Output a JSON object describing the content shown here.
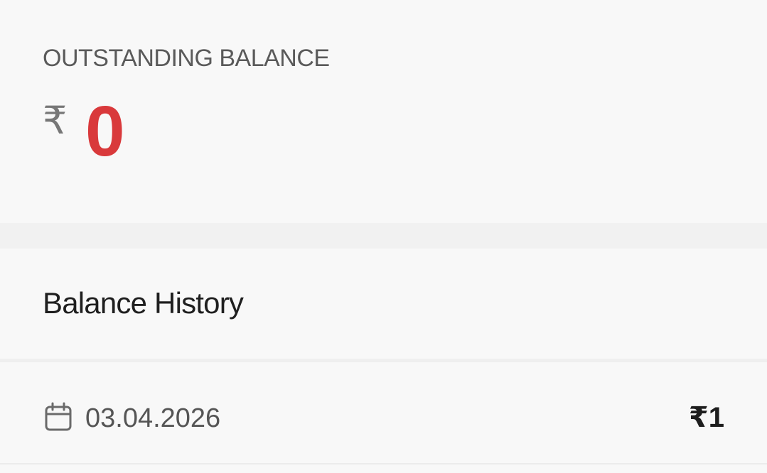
{
  "balance": {
    "label": "OUTSTANDING BALANCE",
    "currency_symbol": "₹",
    "amount": "0",
    "amount_color": "#d9393b"
  },
  "history": {
    "title": "Balance History",
    "entries": [
      {
        "icon": "calendar-icon",
        "date": "03.04.2026",
        "amount": "₹1"
      }
    ]
  }
}
